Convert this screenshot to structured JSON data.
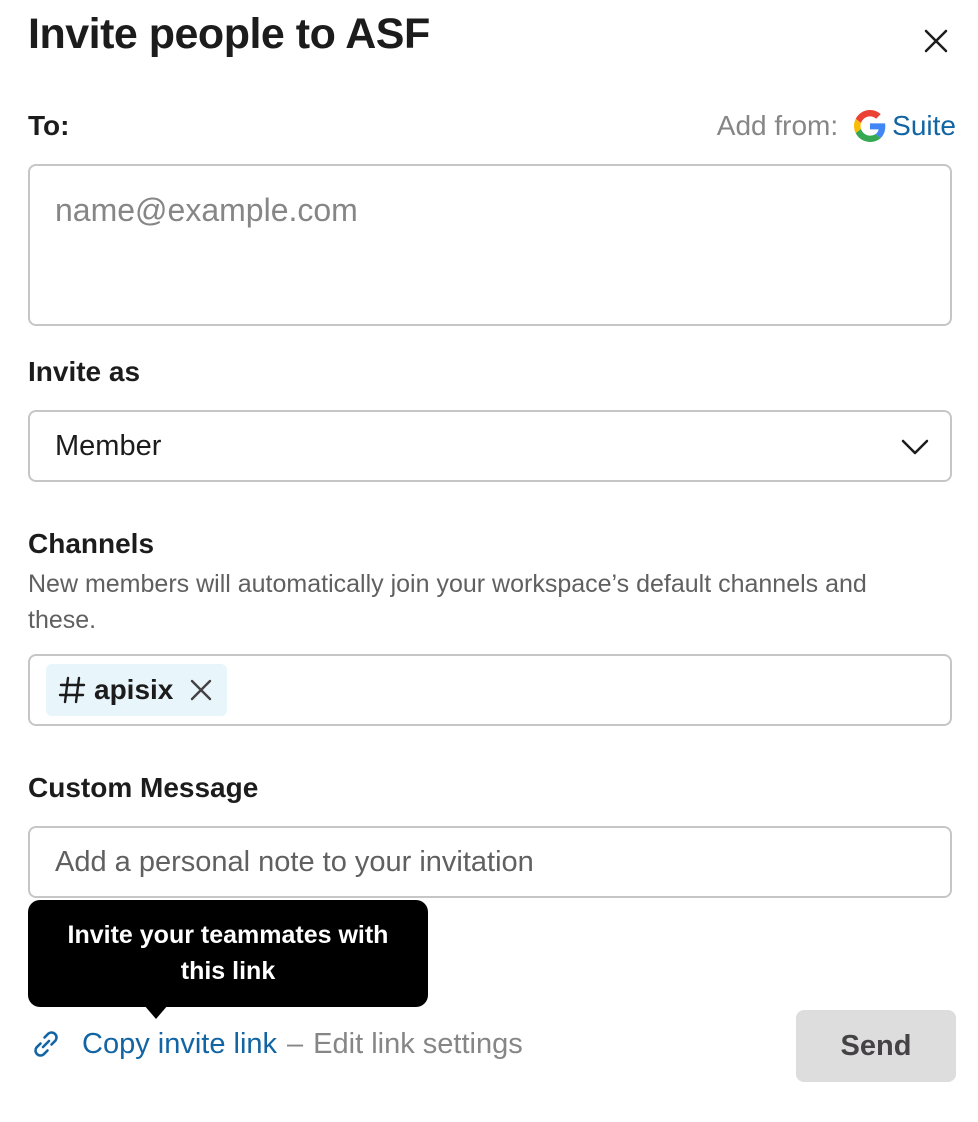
{
  "dialog": {
    "title": "Invite people to ASF",
    "close_icon": "close-icon"
  },
  "to": {
    "label": "To:",
    "add_from_label": "Add from:",
    "suite_label": "Suite",
    "placeholder": "name@example.com"
  },
  "invite_as": {
    "label": "Invite as",
    "selected": "Member"
  },
  "channels": {
    "label": "Channels",
    "helper": "New members will automatically join your workspace’s default channels and these.",
    "chips": [
      {
        "hash": "#",
        "name": "apisix"
      }
    ]
  },
  "custom_message": {
    "label": "Custom Message",
    "placeholder": "Add a personal note to your invitation"
  },
  "tooltip": {
    "text": "Invite your teammates with this link"
  },
  "footer": {
    "copy_link": "Copy invite link",
    "separator": "–",
    "edit_link": "Edit link settings",
    "send": "Send"
  },
  "colors": {
    "link": "#1264a3",
    "muted": "#868686",
    "chip_bg": "#e8f5fa",
    "send_bg": "#dddddd"
  }
}
